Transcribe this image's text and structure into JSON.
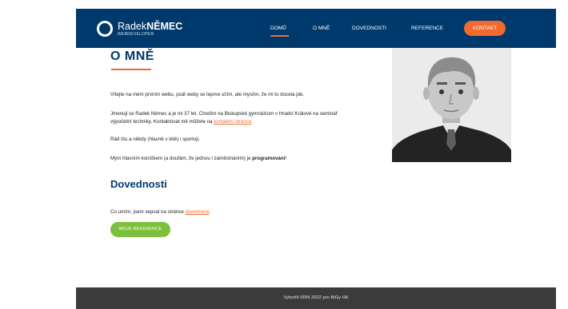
{
  "header": {
    "logo_first": "Radek",
    "logo_last": "NĚMEC",
    "logo_sub": "WEBDEVELOPER",
    "nav": [
      {
        "label": "DOMŮ"
      },
      {
        "label": "O MNĚ"
      },
      {
        "label": "DOVEDNOSTI"
      },
      {
        "label": "REFERENCE"
      }
    ],
    "cta": "KONTAKT"
  },
  "about": {
    "title": "O MNĚ",
    "p1": "Vítejte na mém prvním webu, psát weby se teprve učím, ale myslím, že mi to docela jde.",
    "p2_line1": "Jmenuji se Radek Němec a je mi 37 let. Chodím na Biskupské gymnázium v Hradci Králové na seminář",
    "p2_line2_prefix": "výpočetní techniky. Kontaktovat mě můžete na ",
    "p2_link": "kontaktní stránce",
    "p2_suffix": ".",
    "p3": "Rád čtu a někdy (hlavně v létě) i sportuji.",
    "p4_prefix": "Mým hlavním koníčkem (a doufám, že jednou i zaměstnáním) je ",
    "p4_bold": "programování",
    "p4_suffix": "!"
  },
  "skills": {
    "title": "Dovednosti",
    "text_prefix": "Co umím, jsem sepsal na stránce ",
    "link": "dovednosti",
    "text_suffix": ".",
    "button": "MOJE REFERENCE"
  },
  "footer": {
    "text": "Vytvořil ©RN 2022 pro BiGy HK"
  },
  "colors": {
    "header_bg": "#003a6c",
    "accent": "#f26a2e",
    "button_green": "#7cc13d",
    "footer_bg": "#3b3b3b"
  },
  "icons": {
    "logo": "circle-logo-icon",
    "portrait": "person-avatar-icon"
  }
}
